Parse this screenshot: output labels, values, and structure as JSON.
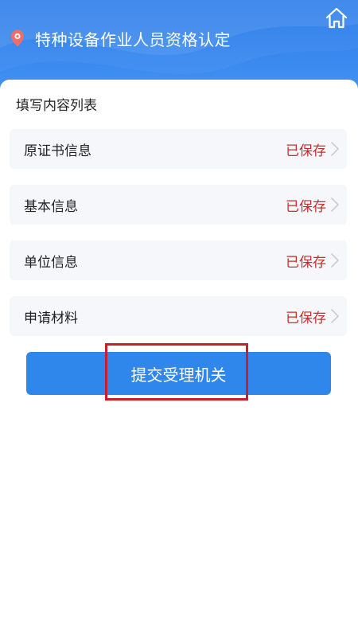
{
  "header": {
    "title": "特种设备作业人员资格认定",
    "icons": {
      "location": "map-pin-icon",
      "home": "home-icon"
    }
  },
  "form": {
    "section_title": "填写内容列表",
    "rows": [
      {
        "label": "原证书信息",
        "status": "已保存"
      },
      {
        "label": "基本信息",
        "status": "已保存"
      },
      {
        "label": "单位信息",
        "status": "已保存"
      },
      {
        "label": "申请材料",
        "status": "已保存"
      }
    ],
    "submit_label": "提交受理机关"
  },
  "colors": {
    "primary": "#2f87ec",
    "status_saved": "#c4302b",
    "highlight": "#c8202a"
  }
}
